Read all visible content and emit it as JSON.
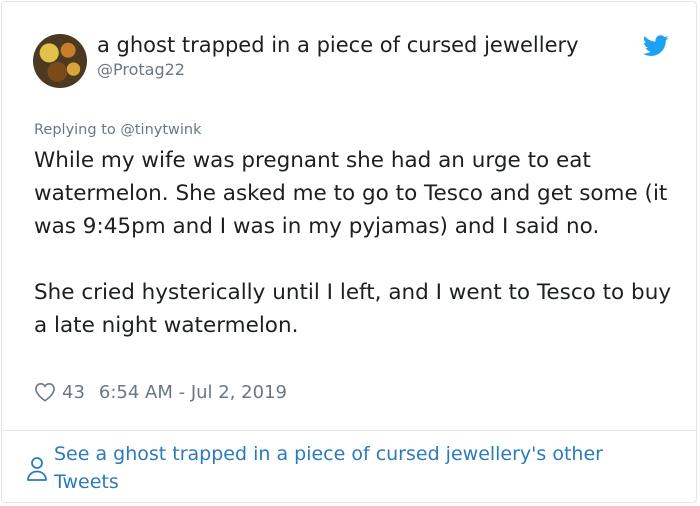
{
  "author": {
    "display_name": "a ghost trapped in a piece of cursed jewellery",
    "handle": "@Protag22"
  },
  "reply": {
    "prefix": "Replying to",
    "mention": "@tinytwink"
  },
  "tweet": {
    "paragraphs": [
      "While my wife was pregnant she had an urge to eat watermelon. She asked me to go to Tesco and get some (it was 9:45pm and I was in my pyjamas) and I said no.",
      "She cried hysterically until I left, and I went to Tesco to buy a late night watermelon."
    ]
  },
  "meta": {
    "likes": "43",
    "timestamp": "6:54 AM - Jul 2, 2019"
  },
  "footer": {
    "link_text": "See a ghost trapped in a piece of cursed jewellery's other Tweets"
  },
  "colors": {
    "text": "#1c2022",
    "muted": "#697882",
    "link": "#2b7bb9",
    "twitter_blue": "#1da1f2",
    "border": "#e1e8ed"
  },
  "icons": {
    "logo": "twitter-bird-icon",
    "like": "heart-icon",
    "profile": "person-icon"
  }
}
